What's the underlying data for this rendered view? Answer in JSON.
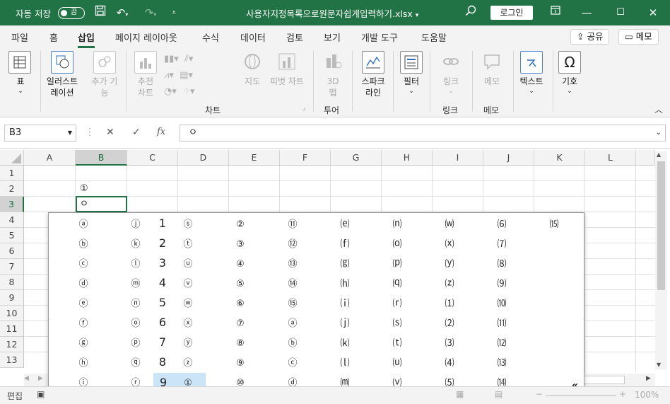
{
  "titlebar": {
    "autosave_label": "자동 저장",
    "autosave_state": "끔",
    "filename": "사용자지정목록으로원문자쉽게입력하기.xlsx",
    "login": "로그인"
  },
  "menu": {
    "tabs": [
      "파일",
      "홈",
      "삽입",
      "페이지 레이아웃",
      "수식",
      "데이터",
      "검토",
      "보기",
      "개발 도구",
      "도움말"
    ],
    "active": "삽입",
    "share": "공유",
    "memo": "메모"
  },
  "ribbon": {
    "table": "표",
    "illustrations": [
      "일러스트",
      "레이션"
    ],
    "addins": [
      "추가 기",
      "능"
    ],
    "recommended_charts": [
      "추천",
      "차트"
    ],
    "maps": "지도",
    "pivot_chart": "피벗 차트",
    "threed_map": [
      "3D",
      "맵"
    ],
    "sparklines": [
      "스파크",
      "라인"
    ],
    "filters": "필터",
    "link": "링크",
    "comment": "메모",
    "text": "텍스트",
    "symbols": "기호",
    "group_labels": {
      "charts": "차트",
      "tours": "투어",
      "links": "링크",
      "comments": "메모"
    }
  },
  "formula_bar": {
    "name_box": "B3",
    "fx": "fx",
    "value": "ㅇ"
  },
  "grid": {
    "columns": [
      "A",
      "B",
      "C",
      "D",
      "E",
      "F",
      "G",
      "H",
      "I",
      "J",
      "K",
      "L"
    ],
    "rows": [
      "1",
      "2",
      "3",
      "4",
      "5",
      "6",
      "7",
      "8",
      "9",
      "10",
      "11",
      "12",
      "13"
    ],
    "cells": {
      "B2": "①",
      "B3": "ㅇ"
    },
    "selected_cell": "B3"
  },
  "ime_candidates": {
    "columns": [
      [
        "ⓐ",
        "ⓑ",
        "ⓒ",
        "ⓓ",
        "ⓔ",
        "ⓕ",
        "ⓖ",
        "ⓗ",
        "ⓘ"
      ],
      [
        "ⓙ",
        "ⓚ",
        "ⓛ",
        "ⓜ",
        "ⓝ",
        "ⓞ",
        "ⓟ",
        "ⓠ",
        "ⓡ"
      ],
      [
        "1",
        "2",
        "3",
        "4",
        "5",
        "6",
        "7",
        "8",
        "9"
      ],
      [
        "ⓢ",
        "ⓣ",
        "ⓤ",
        "ⓥ",
        "ⓦ",
        "ⓧ",
        "ⓨ",
        "ⓩ",
        "①"
      ],
      [
        "②",
        "③",
        "④",
        "⑤",
        "⑥",
        "⑦",
        "⑧",
        "⑨",
        "⑩"
      ],
      [
        "⑪",
        "⑫",
        "⑬",
        "⑭",
        "⑮",
        "ⓐ",
        "ⓑ",
        "ⓒ",
        "ⓓ"
      ],
      [
        "⒠",
        "⒡",
        "⒢",
        "⒣",
        "⒤",
        "⒥",
        "⒦",
        "⒧",
        "⒨"
      ],
      [
        "⒩",
        "⒪",
        "⒫",
        "⒬",
        "⒭",
        "⒮",
        "⒯",
        "⒰",
        "⒱"
      ],
      [
        "⒲",
        "⒳",
        "⒴",
        "⒵",
        "⑴",
        "⑵",
        "⑶",
        "⑷",
        "⑸"
      ],
      [
        "⑹",
        "⑺",
        "⑻",
        "⑼",
        "⑽",
        "⑾",
        "⑿",
        "⒀",
        "⒁"
      ],
      [
        "⒂",
        "",
        "",
        "",
        "",
        "",
        "",
        "",
        ""
      ]
    ],
    "highlighted": "①",
    "more": "«"
  },
  "statusbar": {
    "mode": "편집",
    "zoom": "100%"
  }
}
